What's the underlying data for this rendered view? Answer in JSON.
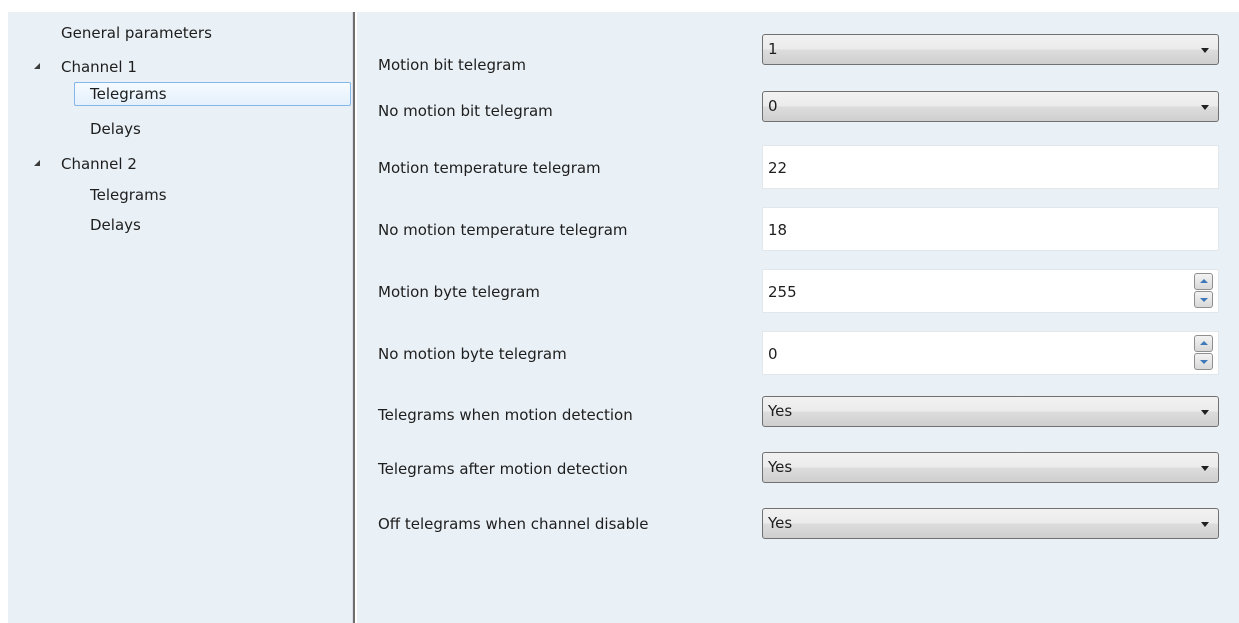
{
  "tree": {
    "general": "General parameters",
    "channel1": {
      "label": "Channel 1",
      "children": [
        "Telegrams",
        "Delays"
      ]
    },
    "channel2": {
      "label": "Channel 2",
      "children": [
        "Telegrams",
        "Delays"
      ]
    },
    "selected": "Channel 1 / Telegrams"
  },
  "params": {
    "motion_bit": {
      "label": "Motion bit telegram",
      "value": "1"
    },
    "no_motion_bit": {
      "label": "No motion bit telegram",
      "value": "0"
    },
    "motion_temp": {
      "label": "Motion temperature telegram",
      "value": "22"
    },
    "no_motion_temp": {
      "label": "No motion temperature telegram",
      "value": "18"
    },
    "motion_byte": {
      "label": "Motion byte telegram",
      "value": "255"
    },
    "no_motion_byte": {
      "label": "No motion byte telegram",
      "value": "0"
    },
    "tel_when_motion": {
      "label": "Telegrams when motion detection",
      "value": "Yes"
    },
    "tel_after_motion": {
      "label": "Telegrams after motion detection",
      "value": "Yes"
    },
    "off_tel_disable": {
      "label": "Off telegrams when channel disable",
      "value": "Yes"
    }
  },
  "icons": {
    "expander": "expanded-triangle-icon",
    "dropdown": "chevron-down-icon",
    "spin_up": "spin-up-icon",
    "spin_down": "spin-down-icon"
  },
  "colors": {
    "panel_background": "#e9f0f6",
    "selection_border": "#84b6e8",
    "spin_arrow": "#3f78b8"
  }
}
